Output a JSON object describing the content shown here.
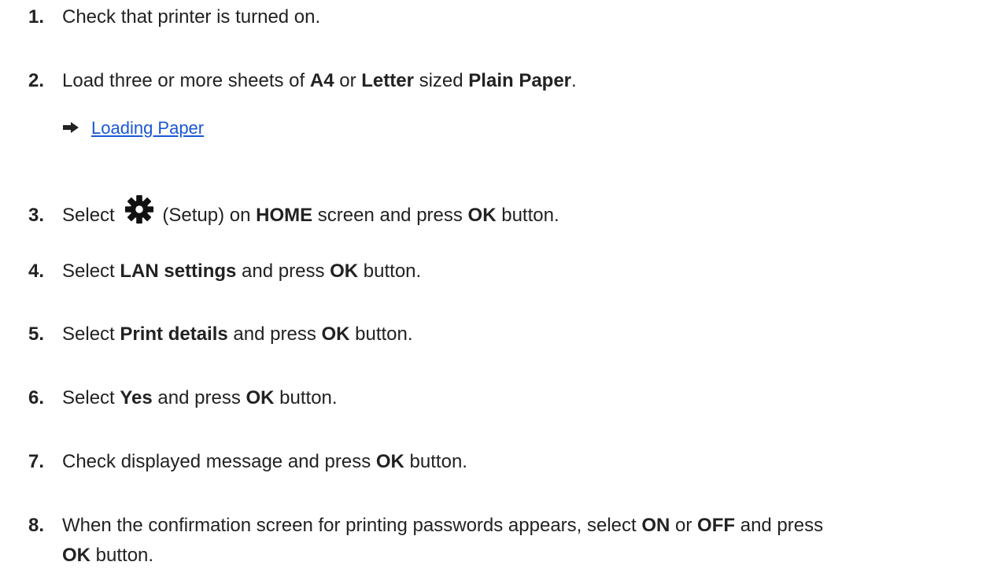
{
  "steps": [
    {
      "num": "1.",
      "parts": [
        "Check that printer is turned on."
      ]
    },
    {
      "num": "2.",
      "parts": [
        "Load three or more sheets of ",
        "A4",
        " or ",
        "Letter",
        " sized ",
        "Plain Paper",
        "."
      ]
    },
    {
      "num": "3.",
      "parts": [
        "Select ",
        "(Setup) on ",
        "HOME",
        " screen and press ",
        "OK",
        " button."
      ]
    },
    {
      "num": "4.",
      "parts": [
        "Select ",
        "LAN settings",
        " and press ",
        "OK",
        " button."
      ]
    },
    {
      "num": "5.",
      "parts": [
        "Select ",
        "Print details",
        " and press ",
        "OK",
        " button."
      ]
    },
    {
      "num": "6.",
      "parts": [
        "Select ",
        "Yes",
        " and press ",
        "OK",
        " button."
      ]
    },
    {
      "num": "7.",
      "parts": [
        "Check displayed message and press ",
        "OK",
        " button."
      ]
    },
    {
      "num": "8.",
      "parts": [
        "When the confirmation screen for printing passwords appears, select ",
        "ON",
        " or ",
        "OFF",
        " and press"
      ],
      "cont": [
        "OK",
        " button."
      ]
    }
  ],
  "link": {
    "label": "Loading Paper",
    "icon": "right-arrow-icon"
  },
  "setup_icon": "gear-icon",
  "colors": {
    "text": "#222222",
    "link": "#1a56d6"
  }
}
